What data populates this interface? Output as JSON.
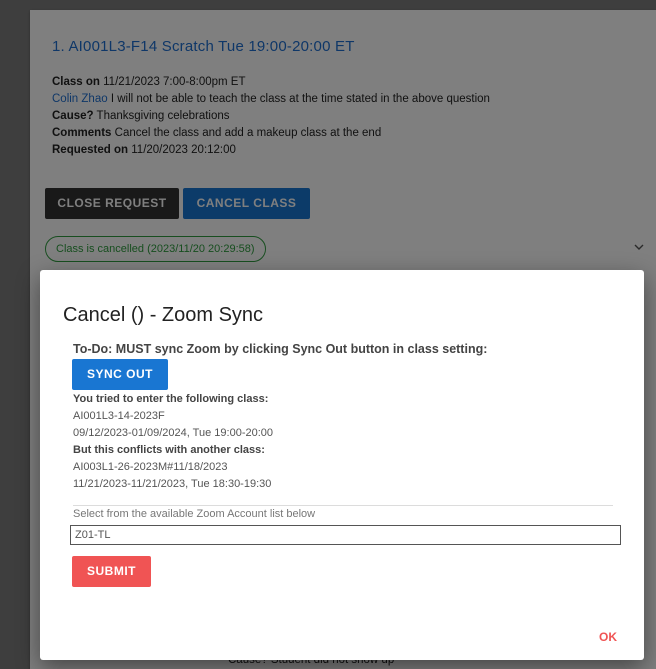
{
  "request": {
    "title": "1. AI001L3-F14 Scratch Tue 19:00-20:00 ET",
    "class_on_label": "Class on",
    "class_on_value": "11/21/2023 7:00-8:00pm ET",
    "teacher_name": "Colin Zhao",
    "teacher_message": "I will not be able to teach the class at the time stated in the above question",
    "cause_label": "Cause?",
    "cause_value": "Thanksgiving celebrations",
    "comments_label": "Comments",
    "comments_value": "Cancel the class and add a makeup class at the end",
    "requested_label": "Requested on",
    "requested_value": "11/20/2023 20:12:00",
    "close_request_label": "CLOSE REQUEST",
    "cancel_class_label": "CANCEL CLASS",
    "status_chip": "Class is cancelled (2023/11/20 20:29:58)",
    "expand_icon": "chevron-down-icon"
  },
  "background_next": {
    "cause_text": "Cause? Student did not show up"
  },
  "dialog": {
    "title": "Cancel () - Zoom Sync",
    "todo_text": "To-Do: MUST sync Zoom by clicking Sync Out button in class setting:",
    "sync_out_label": "SYNC OUT",
    "tried_label": "You tried to enter the following class:",
    "tried_class_code": "AI001L3-14-2023F",
    "tried_class_schedule": "09/12/2023-01/09/2024, Tue 19:00-20:00",
    "conflict_label": "But this conflicts with another class:",
    "conflict_class_code": "AI003L1-26-2023M#11/18/2023",
    "conflict_class_schedule": "11/21/2023-11/21/2023, Tue 18:30-19:30",
    "select_label": "Select from the available Zoom Account list below",
    "zoom_account_value": "Z01-TL",
    "submit_label": "SUBMIT",
    "ok_label": "OK"
  },
  "colors": {
    "primary": "#1976d2",
    "dark_button": "#333333",
    "danger": "#f05454",
    "success": "#2e9c3e",
    "link": "#1f6fd0"
  }
}
